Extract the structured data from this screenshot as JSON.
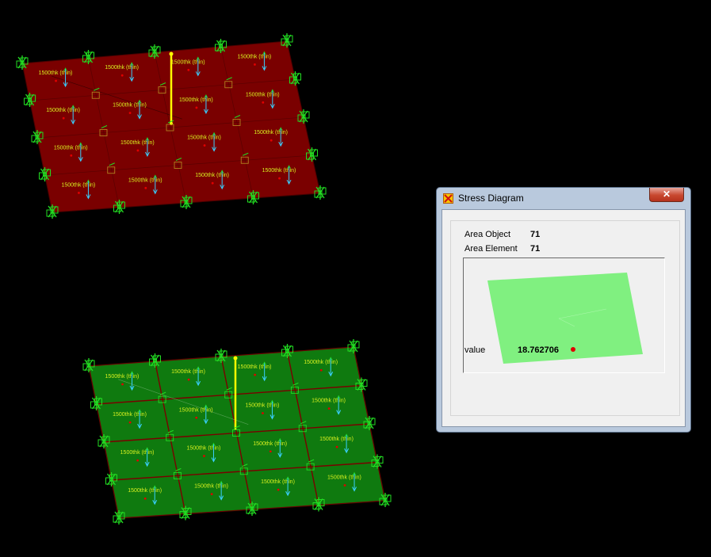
{
  "viewport": {
    "background": "#000000",
    "top_model": {
      "shading": "deformed-red",
      "fill": "#7a0000"
    },
    "bottom_model": {
      "shading": "undeformed-green",
      "fill": "#0f7a0f"
    },
    "section_label": "1500thk (thin)",
    "colors": {
      "restraint": "#22dd22",
      "load_arrow": "#3ad0ff",
      "selected_line": "#ffff00",
      "mesh_line": "#6b0000",
      "label": "#d8f020",
      "node_dot": "#e00000"
    }
  },
  "dialog": {
    "title": "Stress Diagram",
    "close_glyph": "✕",
    "area_object_label": "Area Object",
    "area_object_value": "71",
    "area_element_label": "Area Element",
    "area_element_value": "71",
    "value_label": "value",
    "value_value": "18.762706",
    "preview_fill": "#80f080",
    "preview_point": "#e00000"
  }
}
